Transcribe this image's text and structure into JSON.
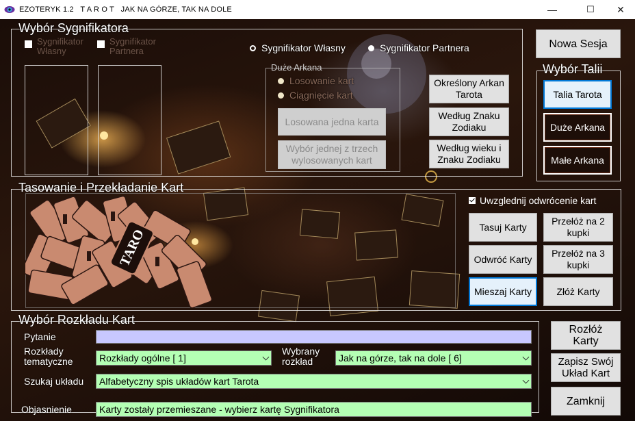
{
  "window": {
    "title": "EZOTERYK 1.2   T A R O T   JAK NA GÓRZE, TAK NA DOLE",
    "min_label": "—",
    "max_label": "☐",
    "close_label": "✕"
  },
  "significator": {
    "legend": "Wybór Sygnifikatora",
    "own_check": "Sygnifikator\nWłasny",
    "partner_check": "Sygnifikator\nPartnera",
    "radio_own": "Sygnifikator Własny",
    "radio_partner": "Sygnifikator Partnera",
    "radio_own_selected": false,
    "radio_partner_selected": true,
    "major": {
      "legend": "Duże Arkana",
      "radio_random": "Losowanie kart",
      "radio_pull": "Ciągnięcie kart",
      "btn_random_one": "Losowana jedna karta",
      "btn_one_of_three": "Wybór jednej z trzech\nwylosowanych kart"
    },
    "btn_specific": "Określony Arkan\nTarota",
    "btn_zodiac": "Według Znaku\nZodiaku",
    "btn_age_zodiac": "Według wieku i\nZnaku Zodiaku"
  },
  "new_session": "Nowa Sesja",
  "deck": {
    "legend": "Wybór Talii",
    "btn_tarot": "Talia Tarota",
    "btn_major": "Duże Arkana",
    "btn_minor": "Małe Arkana"
  },
  "shuffle": {
    "legend": "Tasowanie i Przekładanie Kart",
    "reversal_check": "Uwzglednij odwrócenie kart",
    "btn_shuffle": "Tasuj Karty",
    "btn_cut2": "Przełóż na 2\nkupki",
    "btn_reverse": "Odwróć Karty",
    "btn_cut3": "Przełóż na 3\nkupki",
    "btn_mix": "Mieszaj Karty",
    "btn_gather": "Złóż Karty",
    "card_text": "TARO"
  },
  "spread": {
    "legend": "Wybór Rozkładu Kart",
    "question_label": "Pytanie",
    "question_value": "",
    "thematic_label": "Rozkłady\ntematyczne",
    "thematic_value": "Rozkłady ogólne [ 1]",
    "chosen_label": "Wybrany\nrozkład",
    "chosen_value": "Jak na górze, tak na dole [ 6]",
    "search_label": "Szukaj układu",
    "search_value": "Alfabetyczny spis układów kart Tarota",
    "explain_label": "Objasnienie",
    "explain_value": "Karty zostały przemieszane - wybierz kartę Sygnifikatora"
  },
  "btn_lay_out": "Rozłóż\nKarty",
  "btn_save": "Zapisz Swój\nUkład Kart",
  "btn_close": "Zamknij",
  "colors": {
    "field_green": "#b4ffb4",
    "field_lavender": "#c8c8ff",
    "focus_blue": "#0078d7"
  }
}
